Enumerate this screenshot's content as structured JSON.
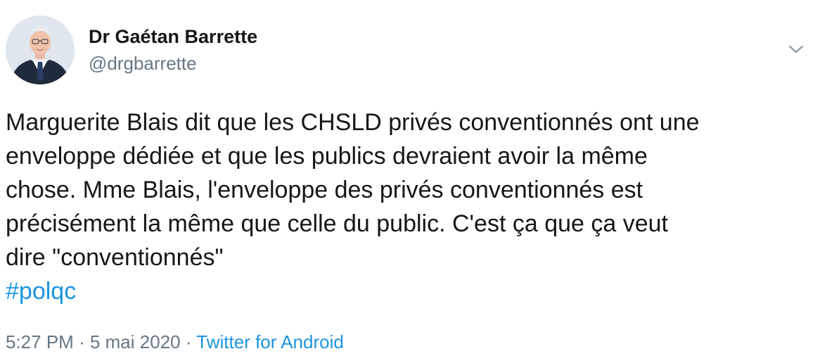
{
  "author": {
    "display_name": "Dr Gaétan Barrette",
    "handle": "@drgbarrette",
    "avatar": "profile-photo"
  },
  "menu": {
    "icon": "chevron-down-icon"
  },
  "tweet": {
    "text": "Marguerite Blais dit que les CHSLD privés conventionnés ont une\nenveloppe dédiée et que les publics devraient avoir la même\nchose. Mme Blais, l'enveloppe des privés conventionnés est\nprécisément la même que celle du public. C'est ça que ça veut\ndire \"conventionnés\"",
    "hashtag": "#polqc"
  },
  "meta": {
    "time": "5:27 PM",
    "separator": "·",
    "date": "5 mai 2020",
    "source": "Twitter for Android"
  },
  "colors": {
    "link": "#1b95e0",
    "secondary": "#657786",
    "text": "#14171a"
  }
}
